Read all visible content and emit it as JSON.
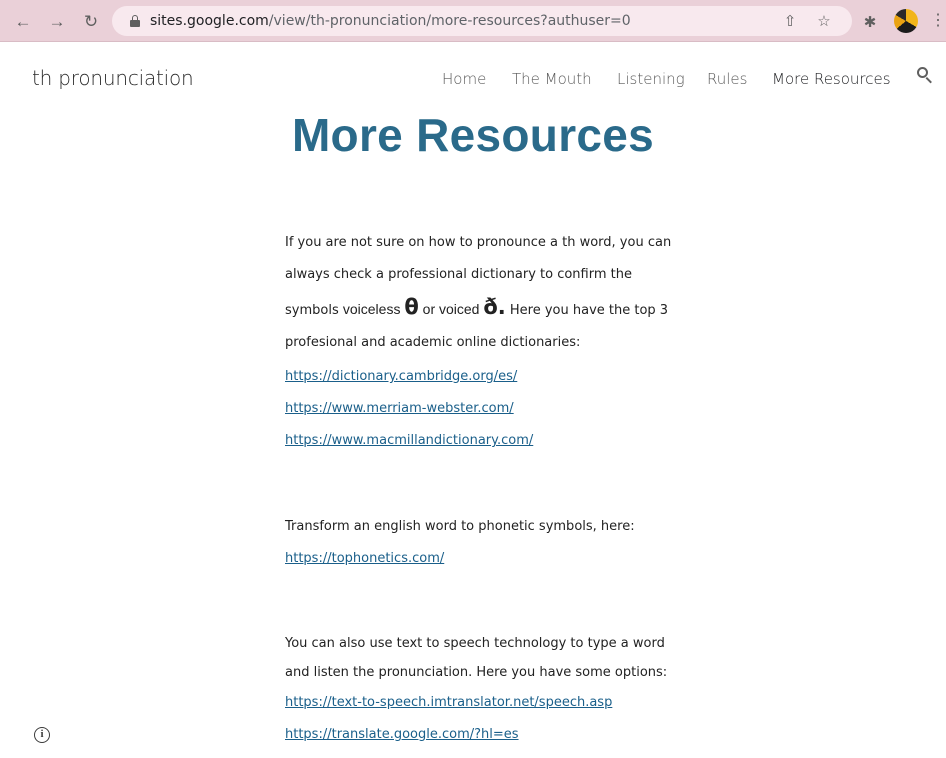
{
  "browser": {
    "url_host": "sites.google.com",
    "url_path": "/view/th-pronunciation/more-resources?authuser=0"
  },
  "site": {
    "title": "th pronunciation",
    "nav": [
      "Home",
      "The Mouth",
      "Listening",
      "Rules",
      "More Resources"
    ],
    "active_nav": "More Resources"
  },
  "page": {
    "title": "More Resources",
    "intro": {
      "text1": "If you are not sure on how to pronounce a th word, you can always check a professional dictionary to confirm the symbols ",
      "voiceless_label": "voiceless ",
      "theta": "θ",
      "voiced_label": " or voiced ",
      "eth": "ð.",
      "text2": "  Here you have the top 3 profesional and academic online dictionaries:"
    },
    "dictionary_links": [
      "https://dictionary.cambridge.org/es/",
      "https://www.merriam-webster.com/",
      "https://www.macmillandictionary.com/"
    ],
    "phonetics_text": "Transform an  english word to phonetic symbols, here:",
    "phonetics_link": "https://tophonetics.com/",
    "tts_text": "You can also use text to speech technology to type a word and listen the pronunciation. Here you have some options:",
    "tts_links": [
      "https://text-to-speech.imtranslator.net/speech.asp",
      "https://translate.google.com/?hl=es"
    ]
  },
  "colors": {
    "title": "#2a6a8a",
    "link": "#1a5f8a",
    "chrome": "#ead0d8"
  },
  "icons": [
    "back-arrow-icon",
    "forward-arrow-icon",
    "reload-icon",
    "lock-icon",
    "share-icon",
    "star-icon",
    "extensions-icon",
    "profile-avatar",
    "menu-kebab-icon",
    "search-icon",
    "info-icon"
  ]
}
